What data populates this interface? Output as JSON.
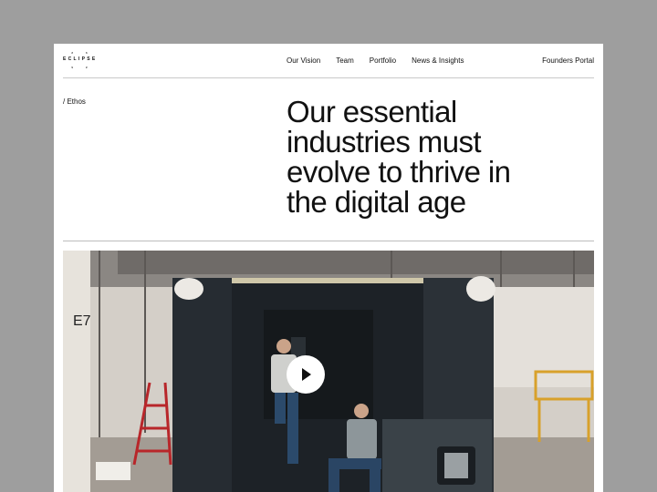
{
  "header": {
    "logo_text": "ECLIPSE",
    "nav": [
      "Our Vision",
      "Team",
      "Portfolio",
      "News & Insights"
    ],
    "portal_label": "Founders Portal"
  },
  "breadcrumb": "/ Ethos",
  "headline": "Our essential industries must evolve to thrive in the digital age",
  "hero": {
    "bay_label": "E7",
    "play_icon": "play-icon"
  }
}
